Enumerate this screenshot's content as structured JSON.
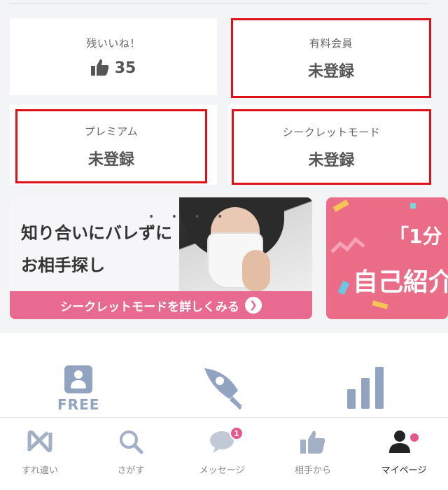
{
  "cards": {
    "likes": {
      "label": "残いいね！",
      "count": "35"
    },
    "paid_member": {
      "label": "有料会員",
      "value": "未登録"
    },
    "premium": {
      "label": "プレミアム",
      "value": "未登録"
    },
    "secret_mode": {
      "label": "シークレットモード",
      "value": "未登録"
    }
  },
  "banners": {
    "secret": {
      "headline_line1": "知り合いにバレずに",
      "headline_line2": "お相手探し",
      "cta": "シークレットモードを詳しくみる"
    },
    "intro": {
      "line1": "「1分",
      "line2": "自己紹介"
    }
  },
  "features": {
    "free_label": "FREE"
  },
  "tabbar": {
    "items": [
      {
        "label": "すれ違い",
        "icon": "passing-icon"
      },
      {
        "label": "さがす",
        "icon": "search-icon"
      },
      {
        "label": "メッセージ",
        "icon": "message-icon",
        "badge": "1"
      },
      {
        "label": "相手から",
        "icon": "thumbs-up-icon"
      },
      {
        "label": "マイページ",
        "icon": "mypage-icon",
        "active": true
      }
    ]
  },
  "colors": {
    "accent_pink": "#e96a91",
    "icon_gray_blue": "#92a3bf",
    "highlight_red": "#e0101a"
  }
}
